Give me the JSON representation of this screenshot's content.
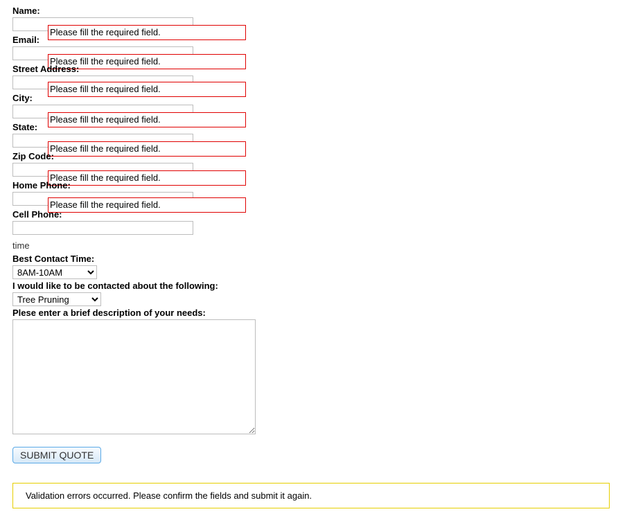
{
  "labels": {
    "name": "Name:",
    "email": "Email:",
    "street": "Street Address:",
    "city": "City:",
    "state": "State:",
    "zip": "Zip Code:",
    "homephone": "Home Phone:",
    "cellphone": "Cell Phone:",
    "time_raw": "time",
    "best_contact": "Best Contact Time:",
    "topic": "I would like to be contacted about the following:",
    "description": "Plese enter a brief description of your needs:"
  },
  "errors": {
    "required": "Please fill the required field.",
    "summary": "Validation errors occurred. Please confirm the fields and submit it again."
  },
  "selects": {
    "time_selected": "8AM-10AM",
    "topic_selected": "Tree Pruning"
  },
  "submit_label": "SUBMIT QUOTE"
}
